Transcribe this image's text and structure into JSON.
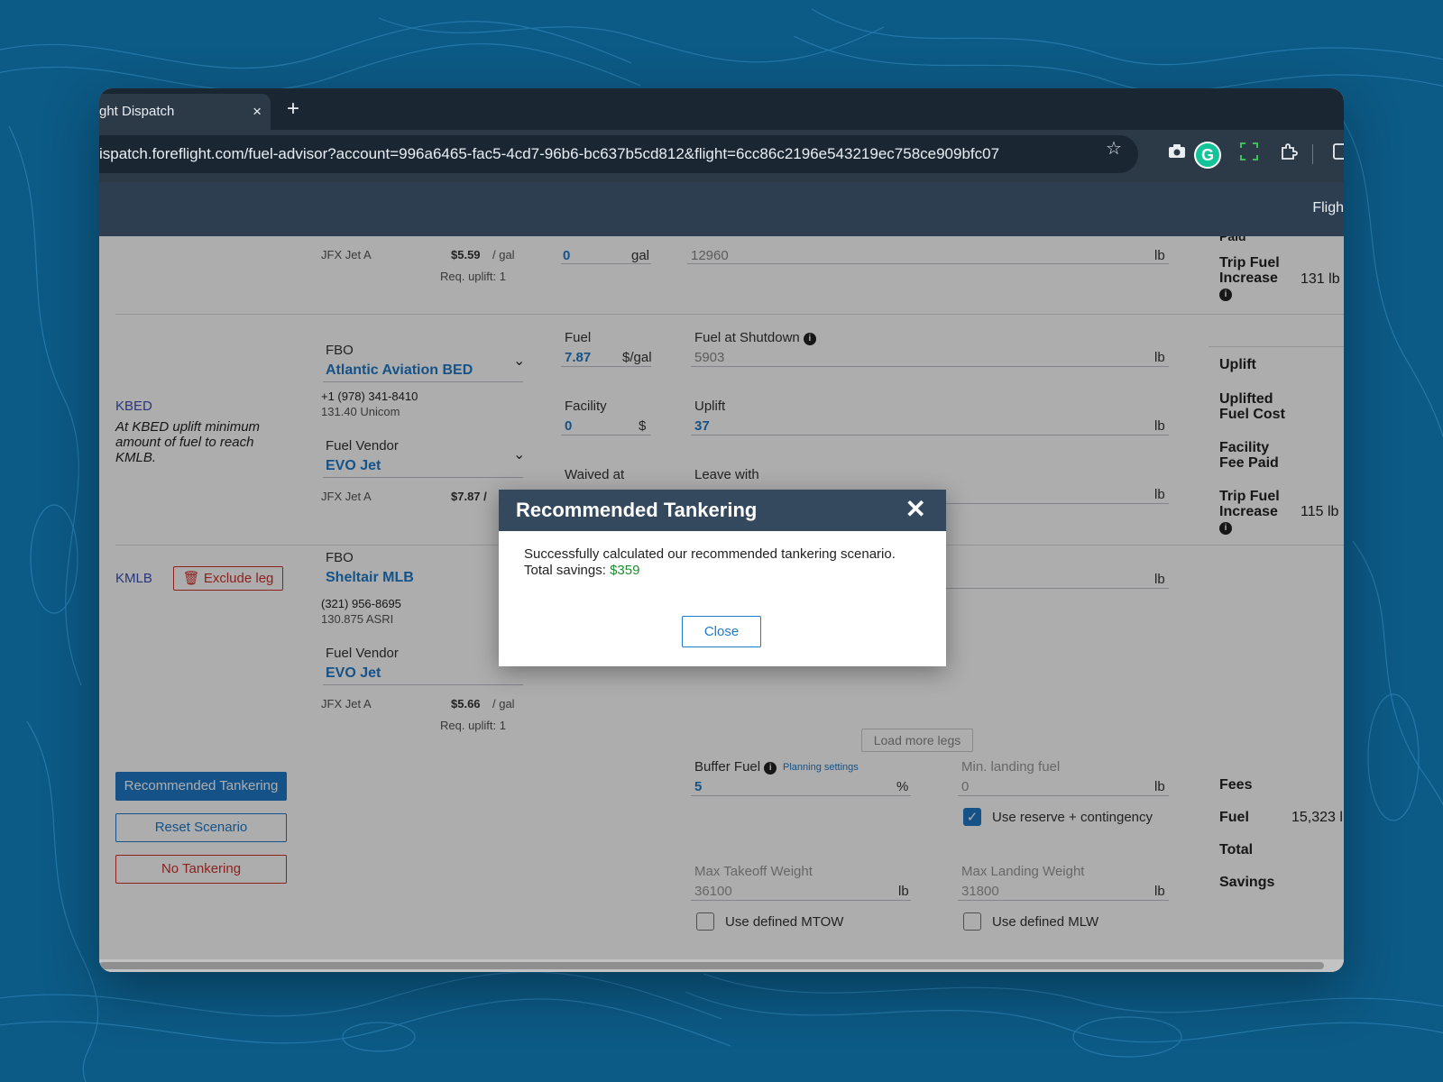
{
  "browser": {
    "tab_title": "ght Dispatch",
    "tab_close": "×",
    "new_tab": "+",
    "url": "ispatch.foreflight.com/fuel-advisor?account=996a6465-fac5-4cd7-96b6-bc637b5cd812&flight=6cc86c2196e543219ec758ce909bfc07"
  },
  "app_header": {
    "nav_partial": "Fligh"
  },
  "leg_prev": {
    "vendor_fuel": "JFX Jet A",
    "price": "$5.59",
    "price_unit": "/ gal",
    "req_uplift": "Req. uplift: 1",
    "gal_value": "0",
    "gal_unit": "gal",
    "shutdown_value": "12960",
    "shutdown_unit": "lb",
    "side": {
      "paid_partial": "Paid",
      "trip_fuel_increase": "Trip Fuel Increase",
      "trip_fuel_increase_value": "131 lb"
    }
  },
  "leg_kbed": {
    "airport": "KBED",
    "note": "At KBED uplift minimum amount of fuel to reach KMLB.",
    "fbo_label": "FBO",
    "fbo_name": "Atlantic Aviation BED",
    "phone": "+1 (978) 341-8410",
    "radio": "131.40 Unicom",
    "vendor_label": "Fuel Vendor",
    "vendor_name": "EVO Jet",
    "vendor_fuel": "JFX Jet A",
    "price": "$7.87 /",
    "fuel_label": "Fuel",
    "fuel_value": "7.87",
    "fuel_unit": "$/gal",
    "facility_label": "Facility",
    "facility_value": "0",
    "facility_unit": "$",
    "waived_label": "Waived at",
    "shutdown_label": "Fuel at Shutdown",
    "shutdown_value": "5903",
    "shutdown_unit": "lb",
    "uplift_label": "Uplift",
    "uplift_value": "37",
    "uplift_unit": "lb",
    "leave_label": "Leave with",
    "leave_unit": "lb",
    "side": {
      "uplift": "Uplift",
      "uplifted_cost": "Uplifted Fuel Cost",
      "facility_fee": "Facility Fee Paid",
      "trip_fuel_increase": "Trip Fuel Increase",
      "trip_fuel_increase_value": "115 lb"
    }
  },
  "leg_kmlb": {
    "airport": "KMLB",
    "exclude_label": "Exclude leg",
    "fbo_label": "FBO",
    "fbo_name": "Sheltair MLB",
    "phone": "(321) 956-8695",
    "radio": "130.875 ASRI",
    "vendor_label": "Fuel Vendor",
    "vendor_name": "EVO Jet",
    "vendor_fuel": "JFX Jet A",
    "price": "$5.66",
    "price_unit": "/ gal",
    "req_uplift": "Req. uplift: 1",
    "unit": "lb"
  },
  "load_more": "Load more legs",
  "actions": {
    "recommended": "Recommended Tankering",
    "reset": "Reset Scenario",
    "none": "No Tankering"
  },
  "settings": {
    "buffer_label": "Buffer Fuel",
    "planning_link": "Planning settings",
    "buffer_value": "5",
    "buffer_unit": "%",
    "min_landing_label": "Min. landing fuel",
    "min_landing_value": "0",
    "min_landing_unit": "lb",
    "reserve_label": "Use reserve + contingency",
    "mtow_label": "Max Takeoff Weight",
    "mtow_value": "36100",
    "mtow_unit": "lb",
    "mlw_label": "Max Landing Weight",
    "mlw_value": "31800",
    "mlw_unit": "lb",
    "use_mtow": "Use defined MTOW",
    "use_mlw": "Use defined MLW"
  },
  "summary": {
    "fees": "Fees",
    "fuel": "Fuel",
    "fuel_value": "15,323 l",
    "total": "Total",
    "savings": "Savings"
  },
  "modal": {
    "title": "Recommended Tankering",
    "close_icon": "✕",
    "message": "Successfully calculated our recommended tankering scenario.",
    "savings_label": "Total savings:",
    "savings_value": "$359",
    "close_button": "Close"
  },
  "colors": {
    "accent": "#1f7ac9",
    "danger": "#d0312d",
    "header": "#34495e",
    "savings": "#1a8f2e",
    "background": "#0c5a86"
  }
}
